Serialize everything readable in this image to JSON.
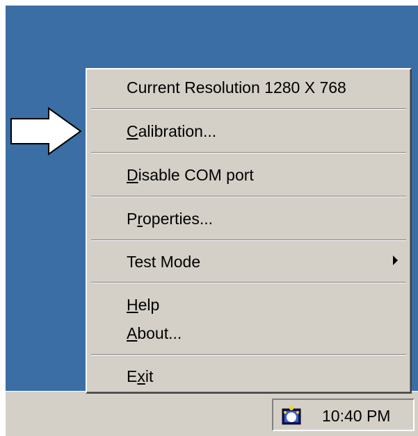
{
  "menu": {
    "resolution": "Current Resolution  1280 X 768",
    "calibration": {
      "key": "C",
      "rest": "alibration..."
    },
    "disable_com": {
      "key": "D",
      "rest": "isable COM port"
    },
    "properties": {
      "pre": "P",
      "key": "r",
      "rest": "operties..."
    },
    "test_mode": "Test Mode",
    "help": {
      "key": "H",
      "rest": "elp"
    },
    "about": {
      "key": "A",
      "rest": "bout..."
    },
    "exit": {
      "pre": "E",
      "key": "x",
      "rest": "it"
    }
  },
  "tray": {
    "clock": "10:40 PM",
    "icon": "touchscreen-tray-icon"
  },
  "colors": {
    "desktop": "#3a6ea5",
    "face": "#d4d0c8",
    "shadow": "#808080",
    "highlight": "#ffffff"
  }
}
